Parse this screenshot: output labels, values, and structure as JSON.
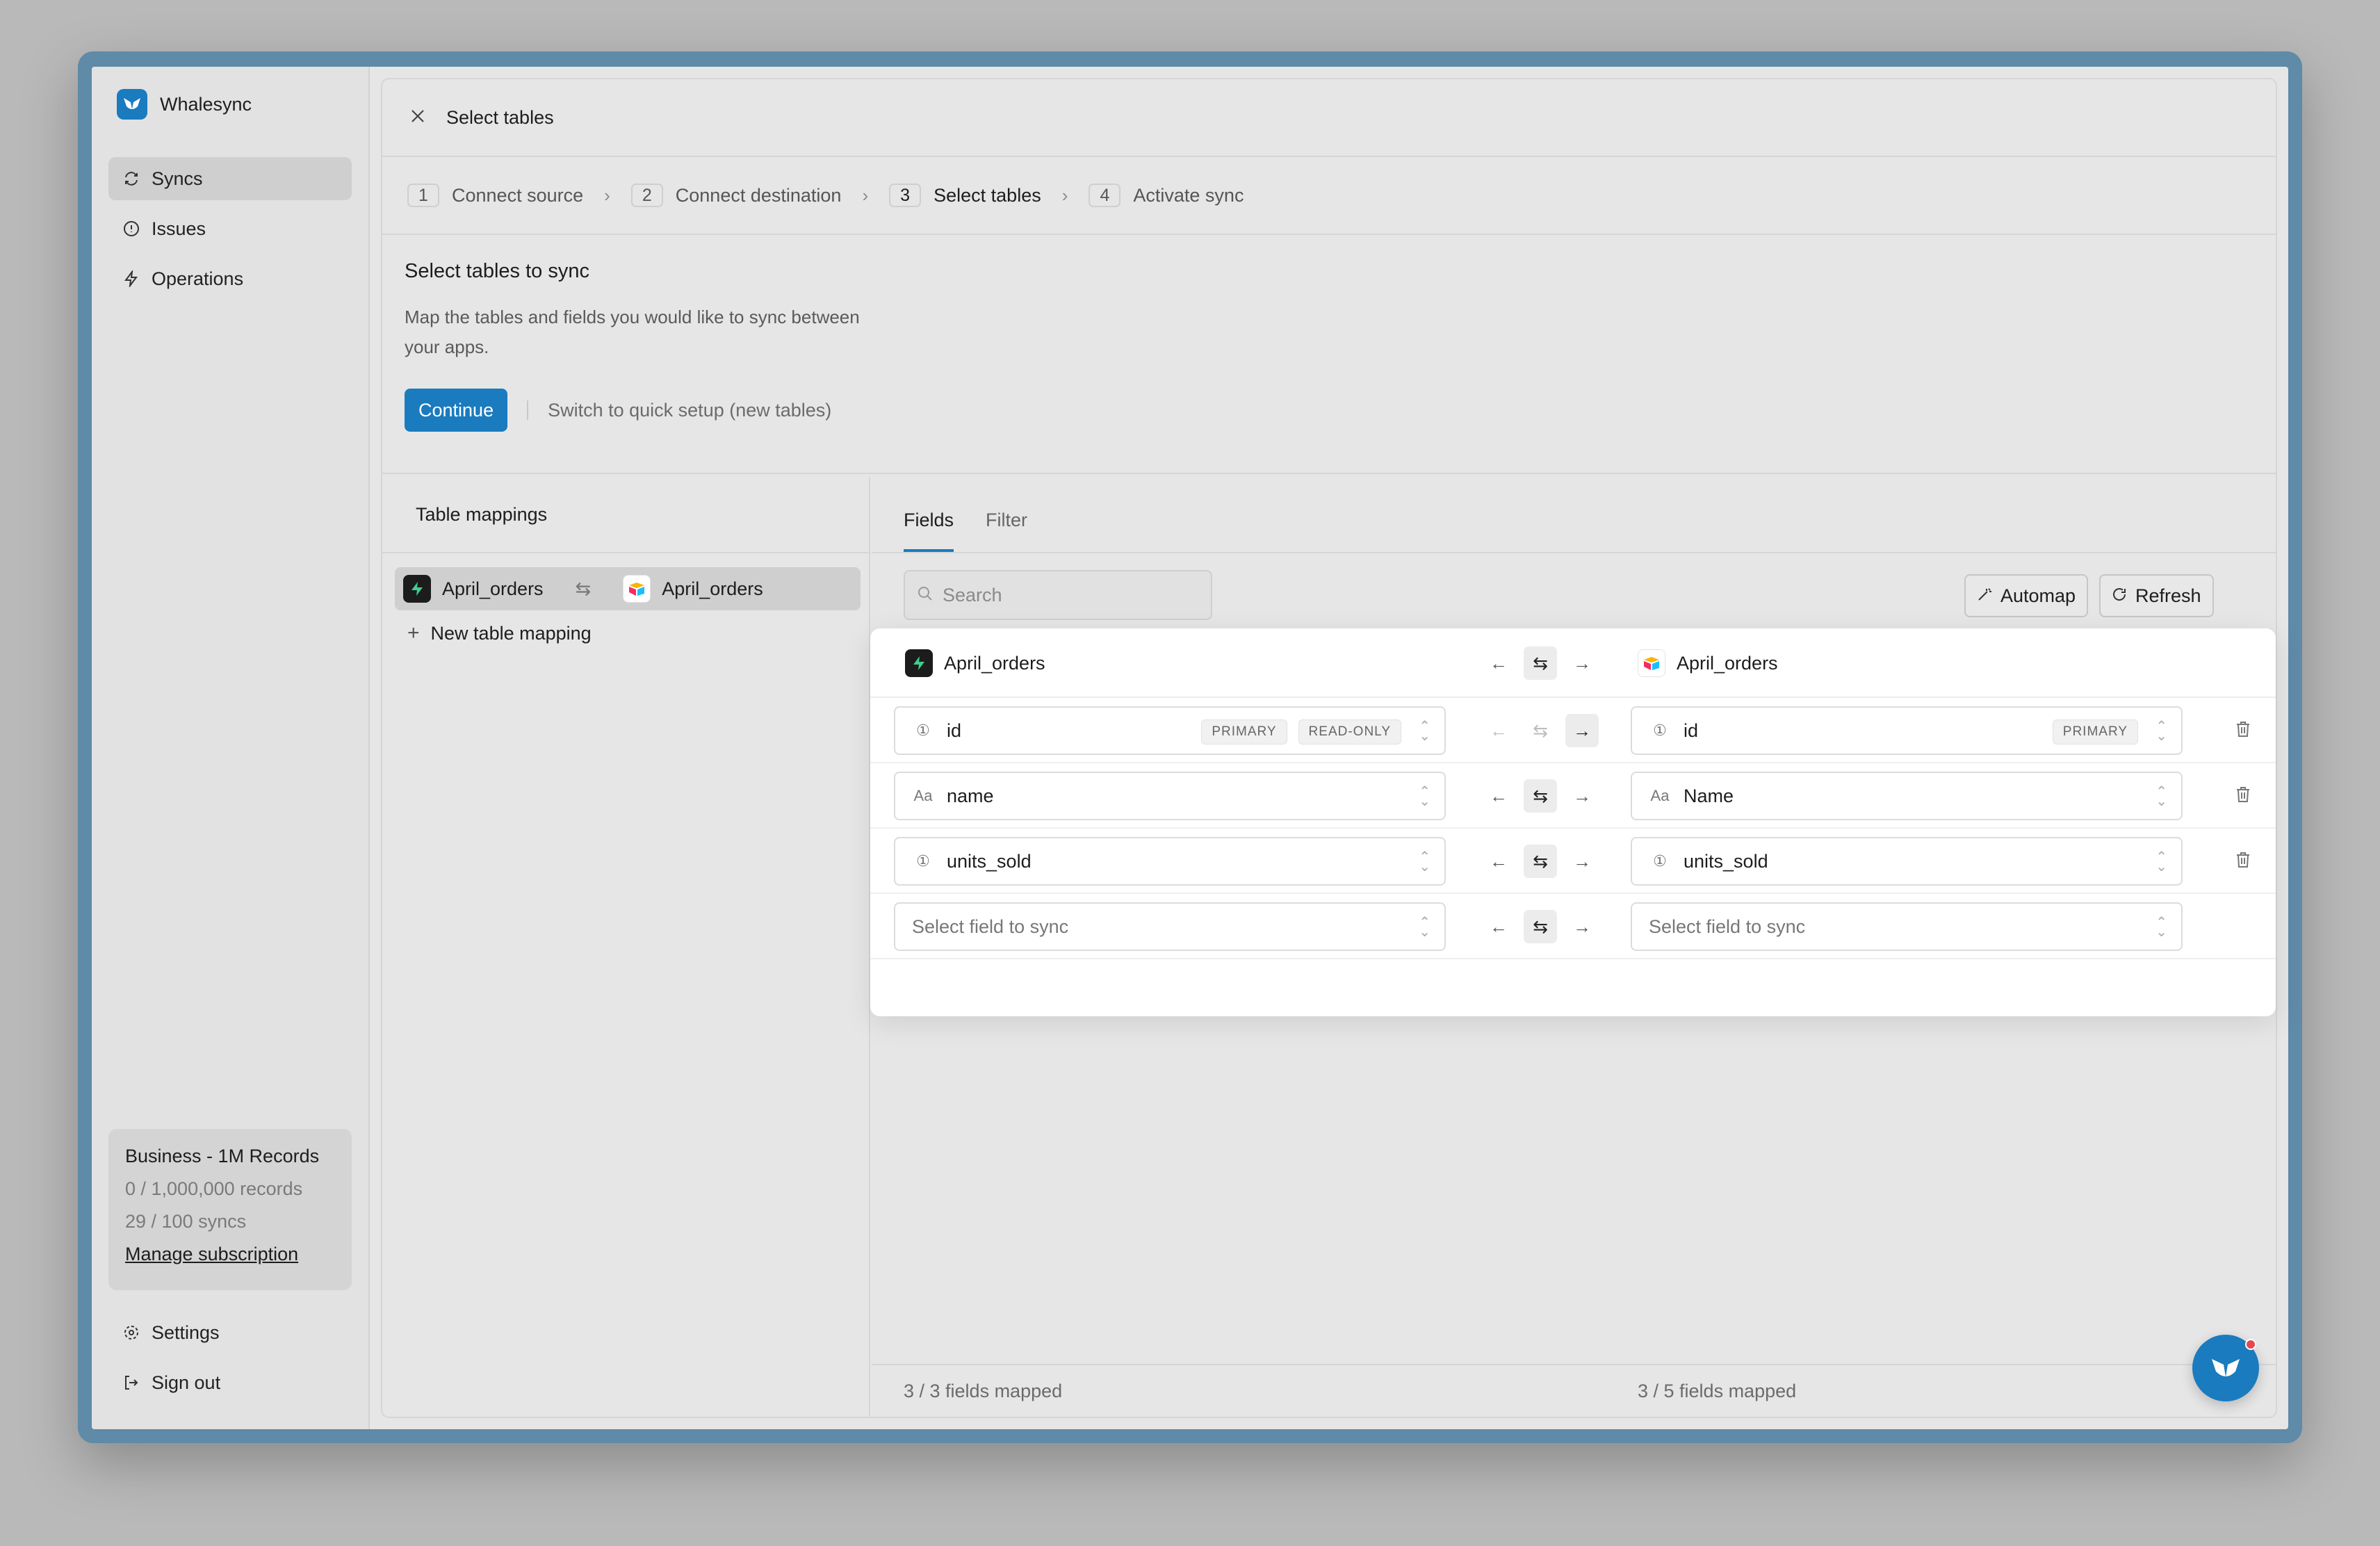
{
  "app": {
    "name": "Whalesync",
    "brand_color": "#1a7bbf"
  },
  "sidebar": {
    "items": [
      {
        "label": "Syncs",
        "icon": "sync-icon",
        "active": true
      },
      {
        "label": "Issues",
        "icon": "alert-circle-icon",
        "active": false
      },
      {
        "label": "Operations",
        "icon": "lightning-icon",
        "active": false
      }
    ],
    "plan": {
      "title": "Business - 1M Records",
      "records": "0 / 1,000,000 records",
      "syncs": "29 / 100 syncs",
      "manage_link": "Manage subscription"
    },
    "bottom": [
      {
        "label": "Settings",
        "icon": "gear-icon"
      },
      {
        "label": "Sign out",
        "icon": "sign-out-icon"
      }
    ]
  },
  "panel": {
    "title": "Select tables",
    "steps": [
      {
        "num": "1",
        "label": "Connect source"
      },
      {
        "num": "2",
        "label": "Connect destination"
      },
      {
        "num": "3",
        "label": "Select tables",
        "active": true
      },
      {
        "num": "4",
        "label": "Activate sync"
      }
    ],
    "intro": {
      "title": "Select tables to sync",
      "description": "Map the tables and fields you would like to sync between your apps.",
      "continue_label": "Continue",
      "quick_setup_label": "Switch to quick setup (new tables)"
    }
  },
  "mappings": {
    "header": "Table mappings",
    "items": [
      {
        "source": "April_orders",
        "destination": "April_orders"
      }
    ],
    "new_label": "New table mapping"
  },
  "fields_panel": {
    "tabs": [
      {
        "label": "Fields",
        "active": true
      },
      {
        "label": "Filter",
        "active": false
      }
    ],
    "search_placeholder": "Search",
    "automap_label": "Automap",
    "refresh_label": "Refresh",
    "left_table": "April_orders",
    "right_table": "April_orders",
    "rows": [
      {
        "left": "id",
        "left_icon": "number-icon",
        "left_tags": [
          "PRIMARY",
          "READ-ONLY"
        ],
        "right": "id",
        "right_icon": "number-icon",
        "right_tags": [
          "PRIMARY"
        ],
        "direction": "right"
      },
      {
        "left": "name",
        "left_icon": "text-icon",
        "left_tags": [],
        "right": "Name",
        "right_icon": "text-icon",
        "right_tags": [],
        "direction": "both"
      },
      {
        "left": "units_sold",
        "left_icon": "number-icon",
        "left_tags": [],
        "right": "units_sold",
        "right_icon": "number-icon",
        "right_tags": [],
        "direction": "both"
      },
      {
        "left_placeholder": "Select field to sync",
        "right_placeholder": "Select field to sync",
        "direction": "both"
      }
    ],
    "left_count": "3 / 3 fields mapped",
    "right_count": "3 / 5 fields mapped"
  }
}
